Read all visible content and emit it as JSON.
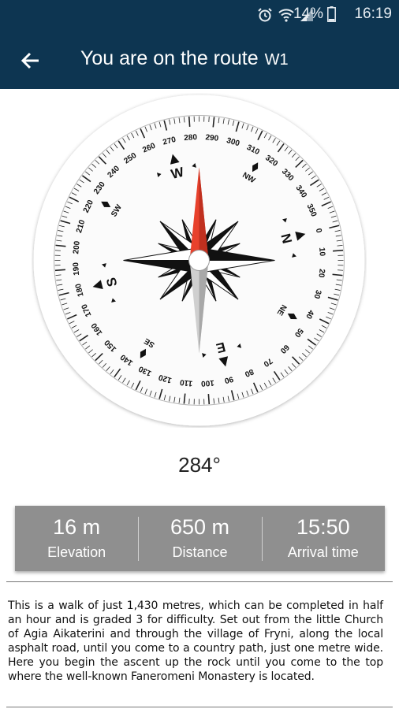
{
  "status_bar": {
    "battery": "14%",
    "time": "16:19",
    "icons": [
      "alarm-icon",
      "wifi-icon",
      "signal-icon",
      "battery-icon"
    ]
  },
  "app_bar": {
    "title": "You are on the route",
    "route": "W1",
    "back_icon": "arrow-left-icon"
  },
  "compass": {
    "bearing_deg": 284,
    "cardinals": [
      "N",
      "E",
      "S",
      "W"
    ],
    "intercardinals": [
      "NE",
      "SE",
      "SW",
      "NW"
    ],
    "degree_labels": [
      "0",
      "10",
      "20",
      "30",
      "40",
      "50",
      "60",
      "70",
      "80",
      "90",
      "100",
      "110",
      "120",
      "130",
      "140",
      "150",
      "160",
      "170",
      "180",
      "190",
      "200",
      "210",
      "220",
      "230",
      "240",
      "250",
      "260",
      "270",
      "280",
      "290",
      "300",
      "310",
      "320",
      "330",
      "340",
      "350"
    ]
  },
  "heading": "284°",
  "stats": [
    {
      "value": "16 m",
      "label": "Elevation"
    },
    {
      "value": "650 m",
      "label": "Distance"
    },
    {
      "value": "15:50",
      "label": "Arrival time"
    }
  ],
  "description": "This is a walk of just 1,430 metres, which can be completed in half an hour and is graded 3 for difficulty. Set out from the little Church of Agia Aikaterini and through the village of Fryni, along the local asphalt road, until you come to a country path, just one metre wide. Here you begin the ascent up the rock until you come to the top where the well-known Faneromeni Monastery is located."
}
